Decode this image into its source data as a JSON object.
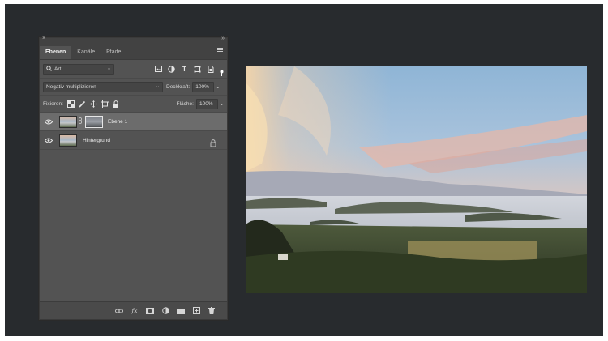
{
  "panel": {
    "close_glyph": "×",
    "collapse_glyph": "»",
    "tabs": [
      {
        "label": "Ebenen",
        "active": true
      },
      {
        "label": "Kanäle",
        "active": false
      },
      {
        "label": "Pfade",
        "active": false
      }
    ],
    "filter_kind": {
      "value": "Art",
      "icon": "search-icon"
    },
    "filter_icons": [
      "pixel-filter-icon",
      "adjustment-filter-icon",
      "type-filter-icon",
      "shape-filter-icon",
      "smart-object-filter-icon"
    ],
    "blend_mode": "Negativ multiplizieren",
    "opacity": {
      "label": "Deckkraft:",
      "value": "100%"
    },
    "lock": {
      "label": "Fixieren:",
      "icons": [
        "lock-transparency-icon",
        "lock-pixels-icon",
        "lock-position-icon",
        "lock-artboard-icon",
        "lock-all-icon"
      ]
    },
    "fill": {
      "label": "Fläche:",
      "value": "100%"
    },
    "layers": [
      {
        "name": "Ebene 1",
        "selected": true,
        "visible": true,
        "has_mask": true,
        "locked": false
      },
      {
        "name": "Hintergrund",
        "selected": false,
        "visible": true,
        "has_mask": false,
        "locked": true
      }
    ],
    "footer_icons": [
      "link-layers-icon",
      "fx-icon",
      "add-mask-icon",
      "adjustment-layer-icon",
      "new-group-icon",
      "new-layer-icon",
      "trash-icon"
    ],
    "fx_label": "fx"
  },
  "colors": {
    "workspace_bg": "#282b2e",
    "panel_bg": "#535353",
    "selected_layer": "#6c6c6c"
  }
}
